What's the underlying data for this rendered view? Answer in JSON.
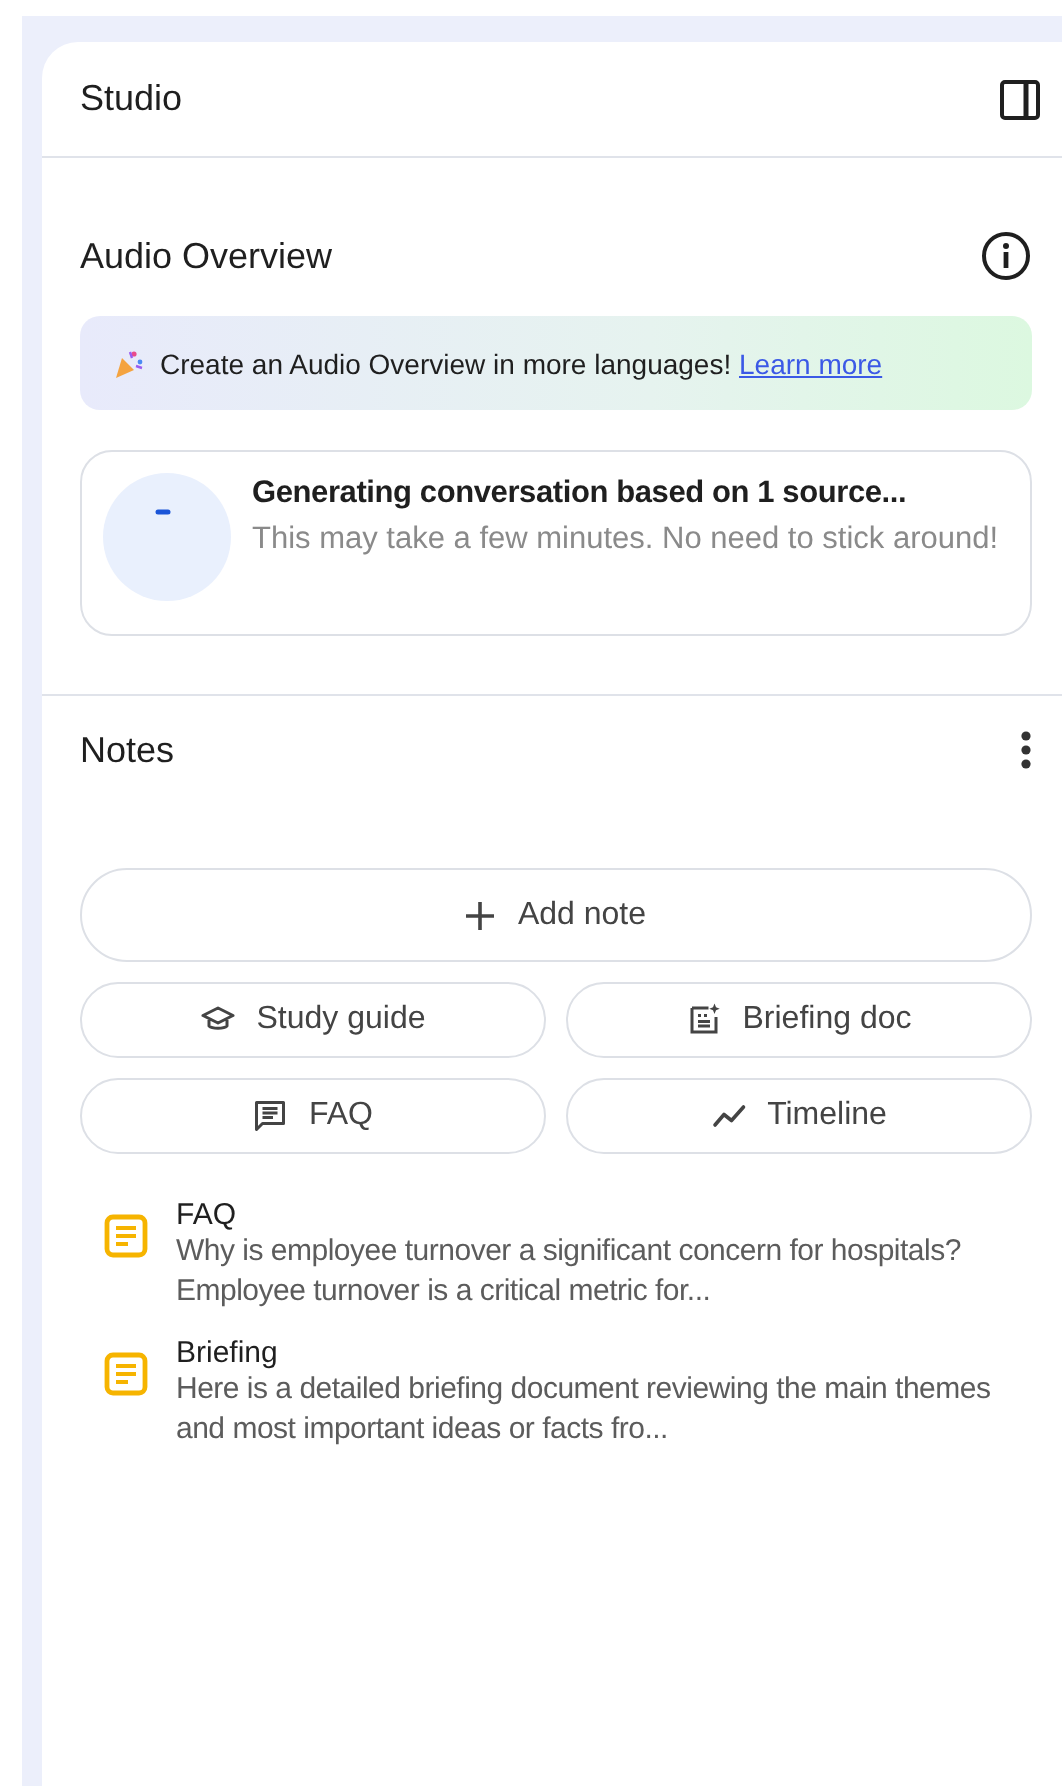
{
  "panel": {
    "title": "Studio"
  },
  "audio_overview": {
    "title": "Audio Overview",
    "banner": {
      "text": "Create an Audio Overview in more languages!",
      "link": "Learn more"
    },
    "status": {
      "title": "Generating conversation based on 1 source...",
      "subtitle": "This may take a few minutes. No need to stick around!"
    }
  },
  "notes": {
    "title": "Notes",
    "add_button": "Add note",
    "actions": [
      {
        "label": "Study guide",
        "kind": "study"
      },
      {
        "label": "Briefing doc",
        "kind": "briefing"
      },
      {
        "label": "FAQ",
        "kind": "faq"
      },
      {
        "label": "Timeline",
        "kind": "timeline"
      }
    ],
    "items": [
      {
        "title": "FAQ",
        "preview": "Why is employee turnover a significant concern for hospitals? Employee turnover is a critical metric for..."
      },
      {
        "title": "Briefing",
        "preview": "Here is a detailed briefing document reviewing the main themes and most important ideas or facts fro..."
      }
    ]
  }
}
